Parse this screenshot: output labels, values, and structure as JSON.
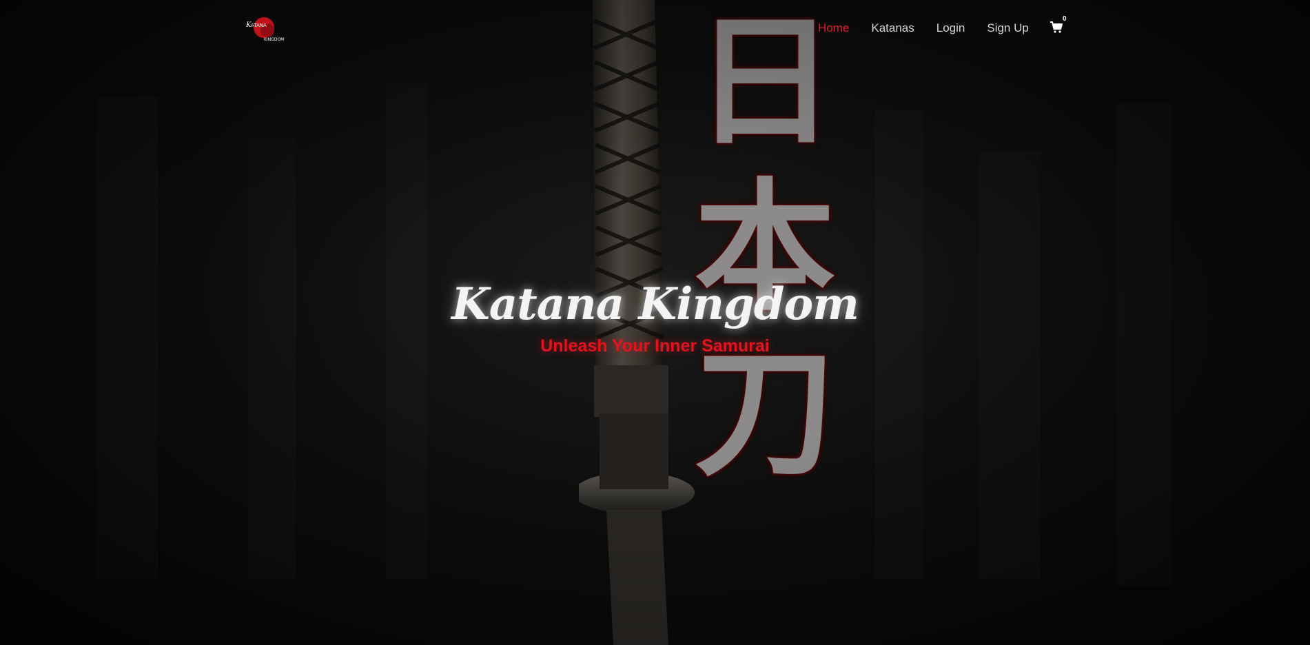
{
  "brand": {
    "logo_text": "KATANA KINGDOM",
    "logo_icon": "katana-kingdom-logo"
  },
  "nav": {
    "items": [
      {
        "label": "Home",
        "active": true
      },
      {
        "label": "Katanas",
        "active": false
      },
      {
        "label": "Login",
        "active": false
      },
      {
        "label": "Sign Up",
        "active": false
      }
    ],
    "cart": {
      "icon": "shopping-cart-icon",
      "count": "0"
    }
  },
  "hero": {
    "title": "Katana Kingdom",
    "subtitle": "Unleash Your Inner Samurai",
    "kanji": [
      "日",
      "本",
      "刀"
    ]
  },
  "colors": {
    "accent": "#e0202a",
    "background": "#060606",
    "nav_text": "#d6d6d6"
  }
}
